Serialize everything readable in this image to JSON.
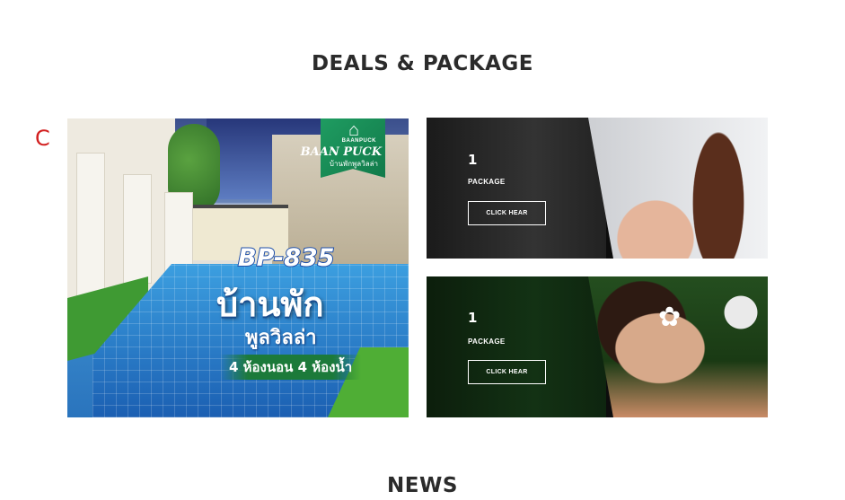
{
  "deals": {
    "title": "DEALS & PACKAGE",
    "stray_char": "C",
    "promo": {
      "logo_small": "BAANPUCK",
      "logo_name": "BAAN PUCK",
      "logo_thai": "บ้านพักพูลวิลล่า",
      "code": "BP-835",
      "thai_headline": "บ้านพัก",
      "thai_sub": "พูลวิลล่า",
      "rooms": "4 ห้องนอน 4 ห้องน้ำ"
    },
    "packages": [
      {
        "count": "1",
        "label": "PACKAGE",
        "button": "CLICK HEAR"
      },
      {
        "count": "1",
        "label": "PACKAGE",
        "button": "CLICK HEAR"
      }
    ]
  },
  "news": {
    "title": "NEWS"
  },
  "colors": {
    "stray_char": "#d21f1f",
    "logo_green": "#1f9c61"
  }
}
